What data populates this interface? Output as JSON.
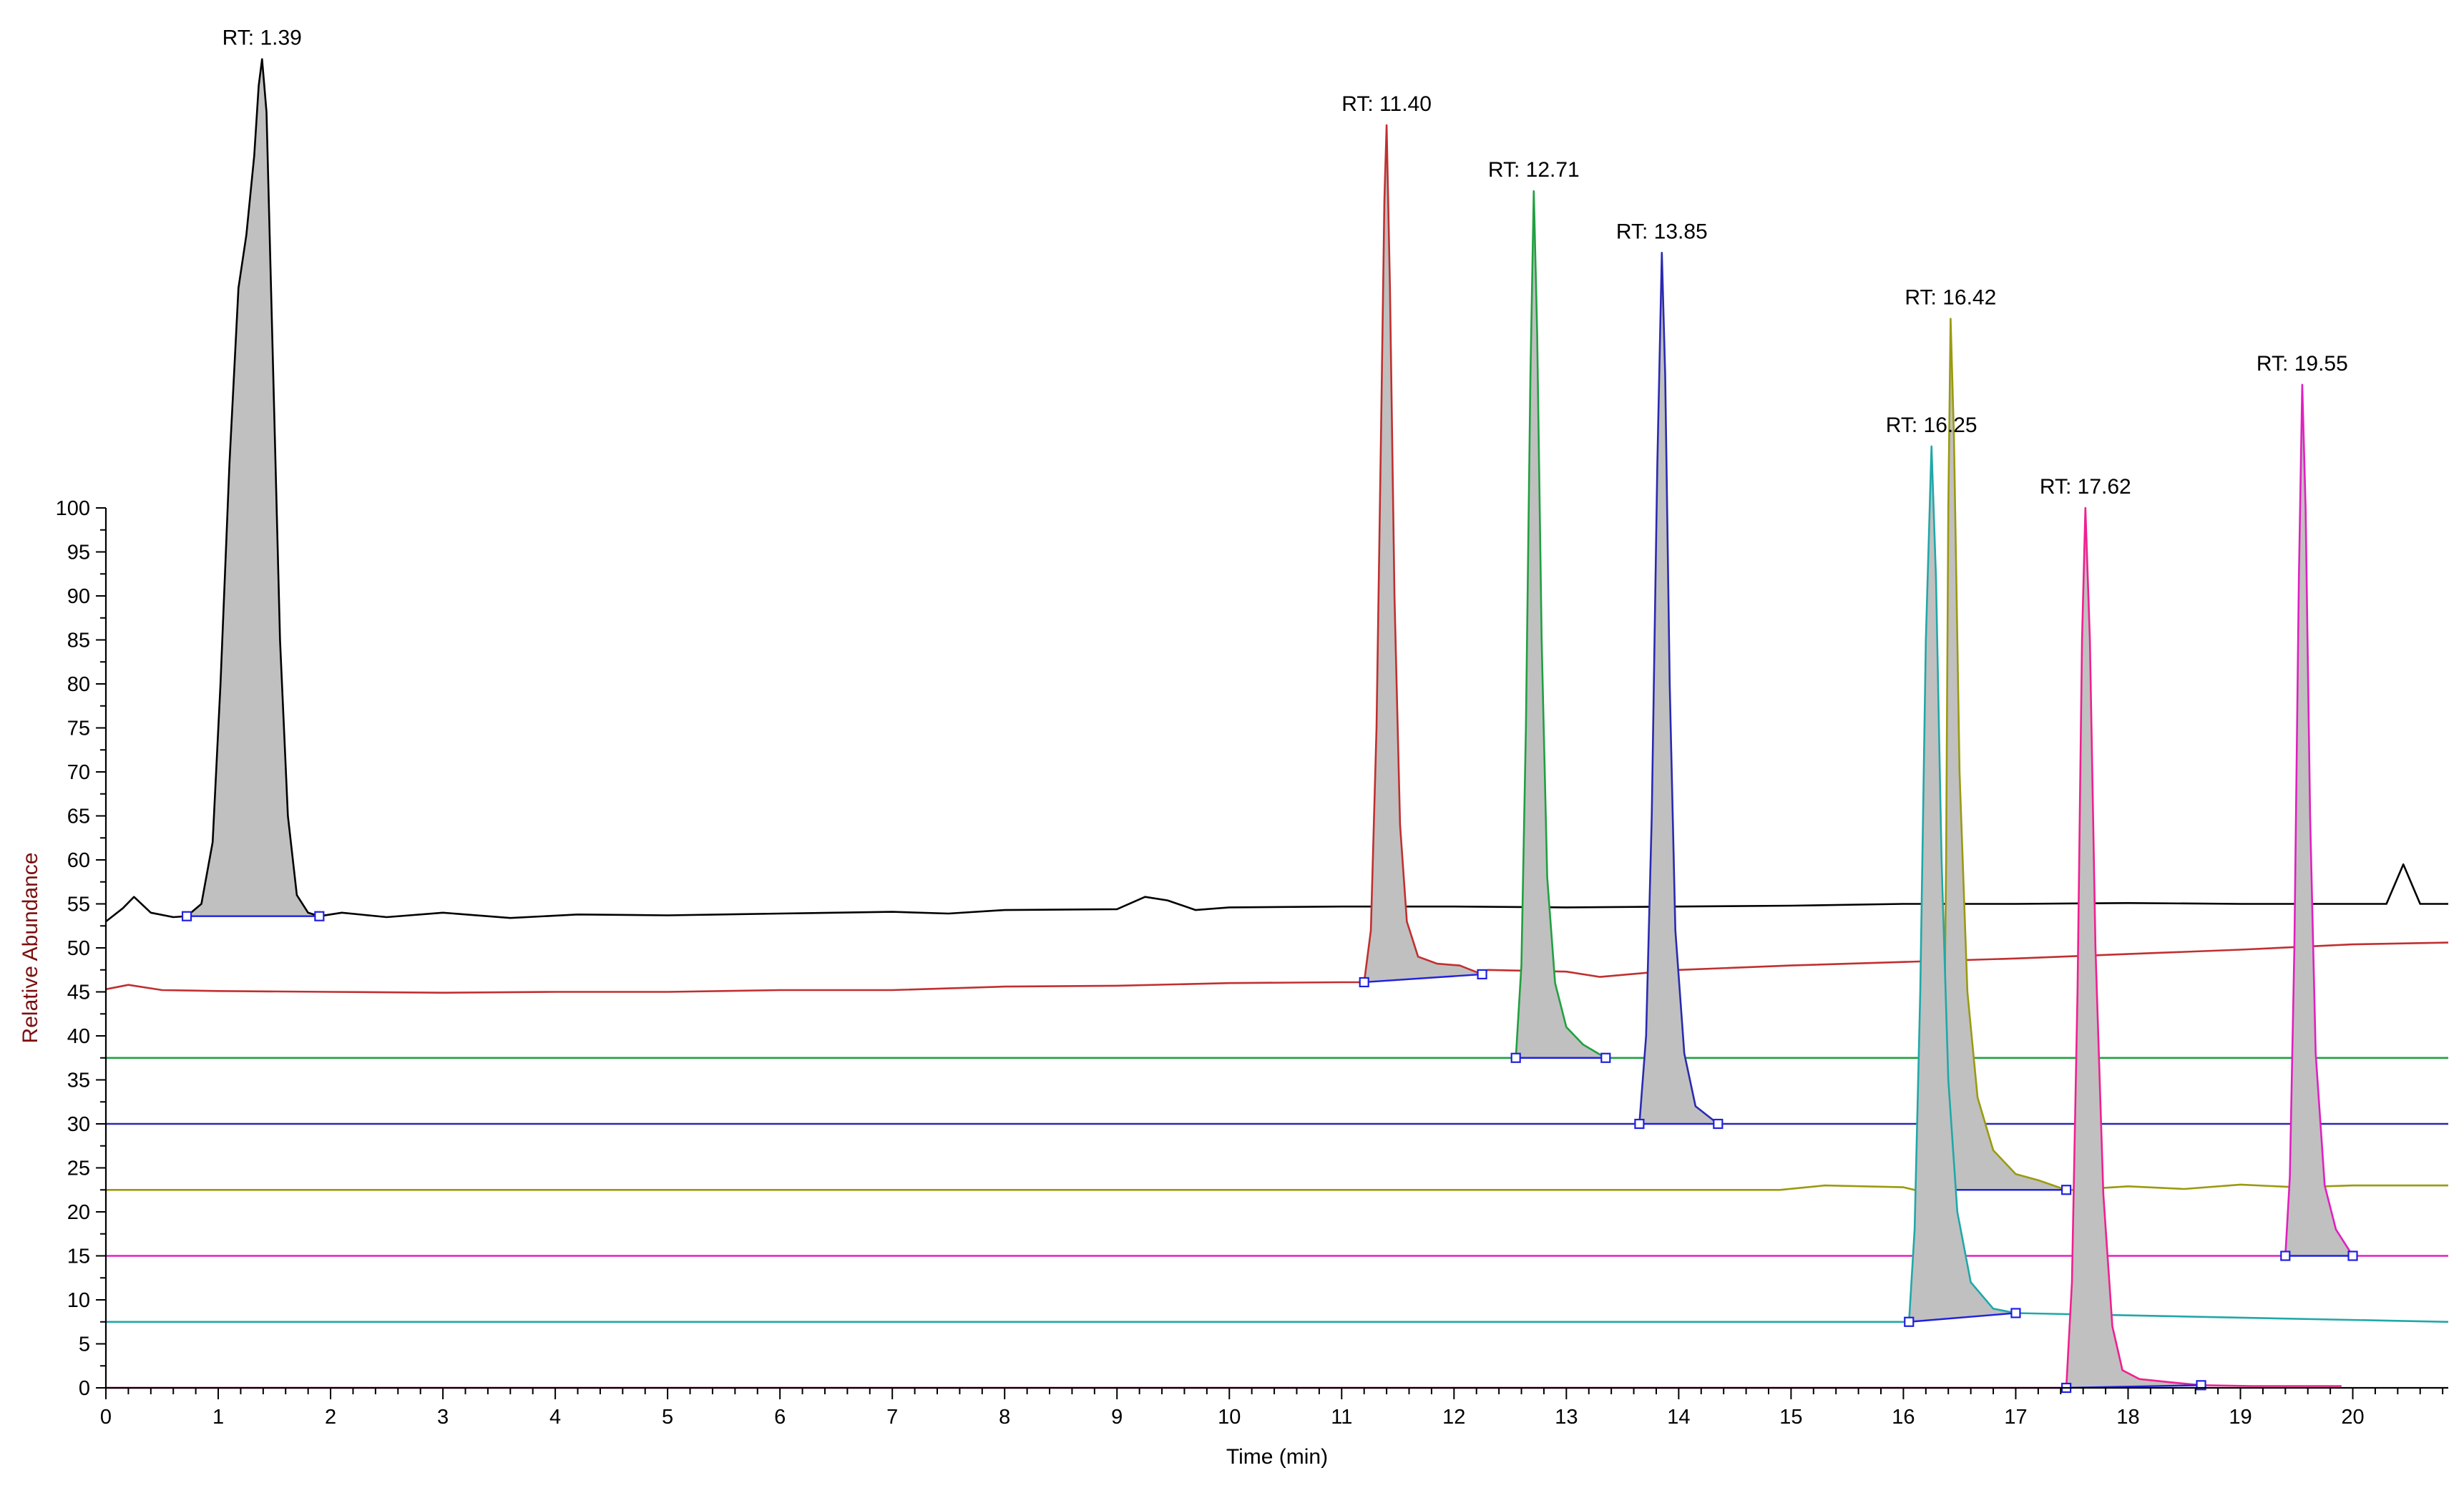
{
  "chart_data": {
    "type": "line",
    "xlabel": "Time (min)",
    "ylabel": "Relative Abundance",
    "xlim": [
      0,
      20.85
    ],
    "ylim": [
      0,
      100
    ],
    "x_ticks": [
      "0",
      "1",
      "2",
      "3",
      "4",
      "5",
      "6",
      "7",
      "8",
      "9",
      "10",
      "11",
      "12",
      "13",
      "14",
      "15",
      "16",
      "17",
      "18",
      "19",
      "20"
    ],
    "y_ticks": [
      "0",
      "5",
      "10",
      "15",
      "20",
      "25",
      "30",
      "35",
      "40",
      "45",
      "50",
      "55",
      "60",
      "65",
      "70",
      "75",
      "80",
      "85",
      "90",
      "95",
      "100"
    ],
    "x_minor_step": 0.2,
    "grid": false,
    "legend": "none",
    "peak_fill_color": "#c0c0c0",
    "integration_line_color": "#2020e0",
    "series": [
      {
        "color": "#000000",
        "baseline": [
          [
            0,
            53
          ],
          [
            0.15,
            54.5
          ],
          [
            0.25,
            55.8
          ],
          [
            0.4,
            54
          ],
          [
            0.6,
            53.5
          ],
          [
            0.75,
            53.7
          ],
          [
            1.9,
            53.6
          ],
          [
            2.1,
            54
          ],
          [
            2.5,
            53.5
          ],
          [
            3,
            54
          ],
          [
            3.6,
            53.4
          ],
          [
            4.2,
            53.8
          ],
          [
            5,
            53.7
          ],
          [
            6,
            53.9
          ],
          [
            7,
            54.1
          ],
          [
            7.5,
            53.9
          ],
          [
            8,
            54.3
          ],
          [
            9,
            54.4
          ],
          [
            9.25,
            55.8
          ],
          [
            9.45,
            55.4
          ],
          [
            9.7,
            54.3
          ],
          [
            10,
            54.6
          ],
          [
            11,
            54.7
          ],
          [
            12,
            54.7
          ],
          [
            13,
            54.6
          ],
          [
            14,
            54.7
          ],
          [
            15,
            54.8
          ],
          [
            16,
            55
          ],
          [
            17,
            55
          ],
          [
            18,
            55.1
          ],
          [
            19,
            55
          ],
          [
            20,
            55
          ],
          [
            20.3,
            55
          ],
          [
            20.45,
            59.5
          ],
          [
            20.6,
            55
          ],
          [
            20.85,
            55
          ]
        ],
        "peak": {
          "rt": 1.39,
          "label": "RT: 1.39",
          "apex": 151,
          "start": 0.72,
          "end": 1.9,
          "profile": [
            [
              0.72,
              53.6
            ],
            [
              0.85,
              55
            ],
            [
              0.95,
              62
            ],
            [
              1.02,
              80
            ],
            [
              1.1,
              105
            ],
            [
              1.18,
              125
            ],
            [
              1.25,
              131
            ],
            [
              1.32,
              140
            ],
            [
              1.36,
              148
            ],
            [
              1.39,
              151
            ],
            [
              1.43,
              145
            ],
            [
              1.48,
              120
            ],
            [
              1.55,
              85
            ],
            [
              1.62,
              65
            ],
            [
              1.7,
              56
            ],
            [
              1.8,
              54
            ],
            [
              1.9,
              53.6
            ]
          ]
        }
      },
      {
        "color": "#c03030",
        "baseline": [
          [
            0,
            45.3
          ],
          [
            0.2,
            45.8
          ],
          [
            0.5,
            45.2
          ],
          [
            1,
            45.1
          ],
          [
            2,
            45
          ],
          [
            3,
            44.9
          ],
          [
            4,
            45
          ],
          [
            5,
            45
          ],
          [
            6,
            45.2
          ],
          [
            7,
            45.2
          ],
          [
            8,
            45.6
          ],
          [
            9,
            45.7
          ],
          [
            10,
            46
          ],
          [
            11,
            46.1
          ],
          [
            11.2,
            46.1
          ],
          [
            12.3,
            47.5
          ],
          [
            13,
            47.3
          ],
          [
            13.3,
            46.7
          ],
          [
            14,
            47.5
          ],
          [
            15,
            48
          ],
          [
            16,
            48.4
          ],
          [
            17,
            48.8
          ],
          [
            18,
            49.3
          ],
          [
            19,
            49.8
          ],
          [
            20,
            50.4
          ],
          [
            20.85,
            50.6
          ]
        ],
        "peak": {
          "rt": 11.4,
          "label": "RT: 11.40",
          "apex": 143.5,
          "start": 11.2,
          "end": 12.25,
          "profile": [
            [
              11.2,
              46.1
            ],
            [
              11.26,
              52
            ],
            [
              11.31,
              75
            ],
            [
              11.35,
              108
            ],
            [
              11.38,
              135
            ],
            [
              11.4,
              143.5
            ],
            [
              11.43,
              125
            ],
            [
              11.47,
              90
            ],
            [
              11.52,
              64
            ],
            [
              11.58,
              53
            ],
            [
              11.68,
              49
            ],
            [
              11.85,
              48.2
            ],
            [
              12.05,
              48
            ],
            [
              12.25,
              47
            ]
          ]
        }
      },
      {
        "color": "#20a040",
        "baseline": [
          [
            0,
            37.5
          ],
          [
            20.85,
            37.5
          ]
        ],
        "peak": {
          "rt": 12.71,
          "label": "RT: 12.71",
          "apex": 136,
          "start": 12.55,
          "end": 13.35,
          "profile": [
            [
              12.55,
              37.5
            ],
            [
              12.6,
              48
            ],
            [
              12.64,
              75
            ],
            [
              12.68,
              115
            ],
            [
              12.71,
              136
            ],
            [
              12.74,
              120
            ],
            [
              12.78,
              85
            ],
            [
              12.83,
              58
            ],
            [
              12.9,
              46
            ],
            [
              13,
              41
            ],
            [
              13.15,
              39
            ],
            [
              13.35,
              37.5
            ]
          ]
        }
      },
      {
        "color": "#2a2ab0",
        "baseline": [
          [
            0,
            30
          ],
          [
            20.85,
            30
          ]
        ],
        "peak": {
          "rt": 13.85,
          "label": "RT: 13.85",
          "apex": 129,
          "start": 13.65,
          "end": 14.35,
          "profile": [
            [
              13.65,
              30
            ],
            [
              13.71,
              40
            ],
            [
              13.76,
              65
            ],
            [
              13.81,
              105
            ],
            [
              13.85,
              129
            ],
            [
              13.88,
              115
            ],
            [
              13.92,
              80
            ],
            [
              13.97,
              52
            ],
            [
              14.05,
              38
            ],
            [
              14.15,
              32
            ],
            [
              14.35,
              30
            ]
          ]
        }
      },
      {
        "color": "#9a9a10",
        "baseline": [
          [
            0,
            22.5
          ],
          [
            14.9,
            22.5
          ],
          [
            15.3,
            23
          ],
          [
            16,
            22.8
          ],
          [
            16.1,
            22.5
          ],
          [
            17.5,
            22.5
          ],
          [
            18,
            22.9
          ],
          [
            18.5,
            22.6
          ],
          [
            19,
            23.1
          ],
          [
            19.5,
            22.8
          ],
          [
            20,
            23
          ],
          [
            20.85,
            23
          ]
        ],
        "peak": {
          "rt": 16.42,
          "label": "RT: 16.42",
          "apex": 121.5,
          "start": 16.35,
          "end": 17.45,
          "profile": [
            [
              16.35,
              22.5
            ],
            [
              16.38,
              60
            ],
            [
              16.4,
              100
            ],
            [
              16.42,
              121.5
            ],
            [
              16.45,
              108
            ],
            [
              16.5,
              70
            ],
            [
              16.57,
              45
            ],
            [
              16.66,
              33
            ],
            [
              16.8,
              27
            ],
            [
              17,
              24.3
            ],
            [
              17.2,
              23.6
            ],
            [
              17.45,
              22.5
            ]
          ]
        }
      },
      {
        "color": "#e020c0",
        "baseline": [
          [
            0,
            15
          ],
          [
            20.85,
            15
          ]
        ],
        "peak": {
          "rt": 19.55,
          "label": "RT: 19.55",
          "apex": 114,
          "start": 19.4,
          "end": 20.0,
          "profile": [
            [
              19.4,
              15
            ],
            [
              19.44,
              24
            ],
            [
              19.48,
              50
            ],
            [
              19.52,
              92
            ],
            [
              19.55,
              114
            ],
            [
              19.58,
              100
            ],
            [
              19.62,
              65
            ],
            [
              19.67,
              38
            ],
            [
              19.75,
              23
            ],
            [
              19.85,
              18
            ],
            [
              20.0,
              15
            ]
          ]
        }
      },
      {
        "color": "#20a8a8",
        "baseline": [
          [
            0,
            7.5
          ],
          [
            20.85,
            7.5
          ]
        ],
        "peak": {
          "rt": 16.25,
          "label": "RT: 16.25",
          "apex": 107,
          "start": 16.05,
          "end": 17.0,
          "profile": [
            [
              16.05,
              7.5
            ],
            [
              16.1,
              18
            ],
            [
              16.15,
              45
            ],
            [
              16.2,
              85
            ],
            [
              16.25,
              107
            ],
            [
              16.29,
              92
            ],
            [
              16.34,
              60
            ],
            [
              16.4,
              35
            ],
            [
              16.48,
              20
            ],
            [
              16.6,
              12
            ],
            [
              16.8,
              9
            ],
            [
              17.0,
              8.5
            ]
          ]
        }
      },
      {
        "color": "#f02090",
        "baseline": [
          [
            0,
            0
          ],
          [
            17.4,
            0
          ],
          [
            18.2,
            0.5
          ],
          [
            18.6,
            0.3
          ],
          [
            19.1,
            0.2
          ],
          [
            19.9,
            0.2
          ]
        ],
        "peak": {
          "rt": 17.62,
          "label": "RT: 17.62",
          "apex": 100,
          "start": 17.45,
          "end": 18.65,
          "profile": [
            [
              17.45,
              0
            ],
            [
              17.5,
              12
            ],
            [
              17.55,
              45
            ],
            [
              17.59,
              85
            ],
            [
              17.62,
              100
            ],
            [
              17.66,
              85
            ],
            [
              17.71,
              50
            ],
            [
              17.78,
              22
            ],
            [
              17.86,
              7
            ],
            [
              17.95,
              2
            ],
            [
              18.1,
              1
            ],
            [
              18.4,
              0.6
            ],
            [
              18.65,
              0.3
            ]
          ]
        }
      }
    ]
  }
}
